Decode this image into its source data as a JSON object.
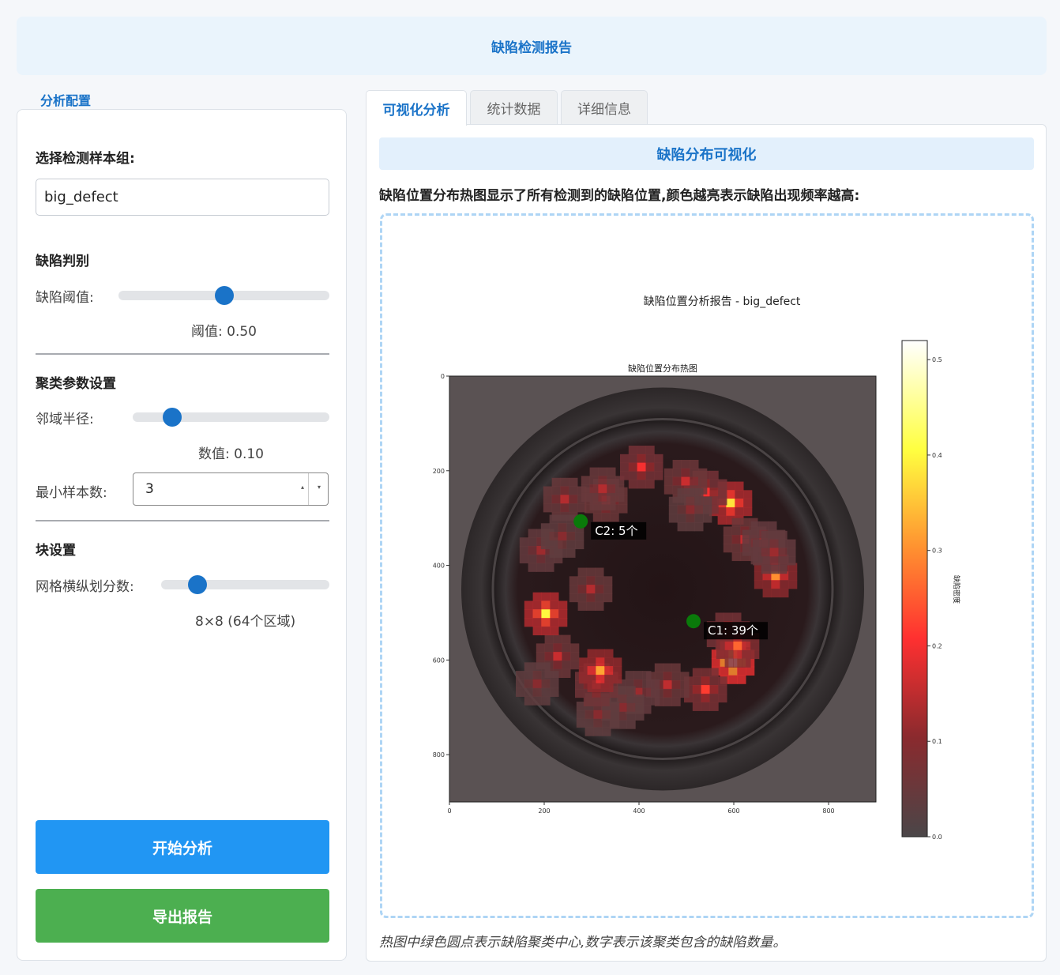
{
  "header": {
    "title": "缺陷检测报告"
  },
  "left": {
    "section_title": "分析配置",
    "sample_group_label": "选择检测样本组:",
    "sample_group_value": "big_defect",
    "defect_judge_title": "缺陷判别",
    "threshold_label": "缺陷阈值:",
    "threshold_value": 0.5,
    "threshold_text": "阈值: 0.50",
    "cluster_title": "聚类参数设置",
    "radius_label": "邻域半径:",
    "radius_value": 0.1,
    "radius_text": "数值: 0.10",
    "min_samples_label": "最小样本数:",
    "min_samples_value": "3",
    "block_title": "块设置",
    "grid_label": "网格横纵划分数:",
    "grid_value": 8,
    "grid_text": "8×8 (64个区域)",
    "start_button": "开始分析",
    "export_button": "导出报告"
  },
  "tabs": [
    {
      "label": "可视化分析",
      "active": true
    },
    {
      "label": "统计数据",
      "active": false
    },
    {
      "label": "详细信息",
      "active": false
    }
  ],
  "visual": {
    "title": "缺陷分布可视化",
    "description": "缺陷位置分布热图显示了所有检测到的缺陷位置,颜色越亮表示缺陷出现频率越高:",
    "caption": "热图中绿色圆点表示缺陷聚类中心,数字表示该聚类包含的缺陷数量。"
  },
  "chart_data": {
    "type": "heatmap",
    "title": "缺陷位置分析报告 - big_defect",
    "subtitle": "缺陷位置分布热图",
    "xlim": [
      0,
      900
    ],
    "ylim": [
      900,
      0
    ],
    "x_ticks": [
      0,
      200,
      400,
      600,
      800
    ],
    "y_ticks": [
      0,
      200,
      400,
      600,
      800
    ],
    "colorbar": {
      "label": "缺陷密度",
      "range": [
        0,
        0.52
      ],
      "ticks": [
        0.0,
        0.1,
        0.2,
        0.3,
        0.4,
        0.5
      ]
    },
    "clusters": [
      {
        "label": "C1: 39个",
        "x": 515,
        "y": 518
      },
      {
        "label": "C2: 5个",
        "x": 277,
        "y": 307
      }
    ],
    "hotspots": [
      {
        "x": 593,
        "y": 268,
        "v": 0.38
      },
      {
        "x": 540,
        "y": 245,
        "v": 0.2
      },
      {
        "x": 498,
        "y": 222,
        "v": 0.16
      },
      {
        "x": 623,
        "y": 345,
        "v": 0.16
      },
      {
        "x": 663,
        "y": 352,
        "v": 0.12
      },
      {
        "x": 688,
        "y": 422,
        "v": 0.3
      },
      {
        "x": 588,
        "y": 545,
        "v": 0.2
      },
      {
        "x": 598,
        "y": 605,
        "v": 0.52
      },
      {
        "x": 608,
        "y": 570,
        "v": 0.26
      },
      {
        "x": 540,
        "y": 662,
        "v": 0.22
      },
      {
        "x": 460,
        "y": 652,
        "v": 0.15
      },
      {
        "x": 398,
        "y": 668,
        "v": 0.12
      },
      {
        "x": 365,
        "y": 700,
        "v": 0.1
      },
      {
        "x": 313,
        "y": 715,
        "v": 0.1
      },
      {
        "x": 310,
        "y": 652,
        "v": 0.18
      },
      {
        "x": 318,
        "y": 622,
        "v": 0.32
      },
      {
        "x": 228,
        "y": 592,
        "v": 0.16
      },
      {
        "x": 185,
        "y": 650,
        "v": 0.1
      },
      {
        "x": 203,
        "y": 502,
        "v": 0.4
      },
      {
        "x": 298,
        "y": 450,
        "v": 0.14
      },
      {
        "x": 193,
        "y": 368,
        "v": 0.12
      },
      {
        "x": 243,
        "y": 260,
        "v": 0.14
      },
      {
        "x": 238,
        "y": 338,
        "v": 0.1
      },
      {
        "x": 330,
        "y": 262,
        "v": 0.16
      },
      {
        "x": 323,
        "y": 238,
        "v": 0.14
      },
      {
        "x": 405,
        "y": 192,
        "v": 0.2
      },
      {
        "x": 508,
        "y": 282,
        "v": 0.1
      },
      {
        "x": 685,
        "y": 372,
        "v": 0.12
      }
    ]
  }
}
